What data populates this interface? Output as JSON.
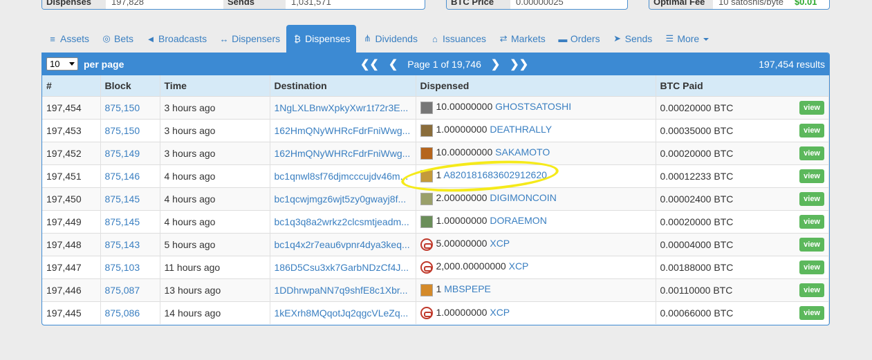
{
  "stats": [
    {
      "label": "Dispenses",
      "value": "197,828"
    },
    {
      "label": "Sends",
      "value": "1,031,571"
    },
    {
      "label": "BTC Price",
      "value": "0.00000025"
    },
    {
      "label": "Optimal Fee",
      "value": "10 satoshis/byte",
      "extra": "$0.01"
    }
  ],
  "tabs": [
    {
      "label": "Assets",
      "icon": "database-icon",
      "glyph": "≡"
    },
    {
      "label": "Bets",
      "icon": "target-icon",
      "glyph": "◎"
    },
    {
      "label": "Broadcasts",
      "icon": "bullhorn-icon",
      "glyph": "◄"
    },
    {
      "label": "Dispensers",
      "icon": "arrows-h-icon",
      "glyph": "↔"
    },
    {
      "label": "Dispenses",
      "icon": "bitcoin-icon",
      "glyph": "₿"
    },
    {
      "label": "Dividends",
      "icon": "sitemap-icon",
      "glyph": "⋔"
    },
    {
      "label": "Issuances",
      "icon": "bank-icon",
      "glyph": "⌂"
    },
    {
      "label": "Markets",
      "icon": "exchange-icon",
      "glyph": "⇄"
    },
    {
      "label": "Orders",
      "icon": "book-icon",
      "glyph": "▬"
    },
    {
      "label": "Sends",
      "icon": "paper-plane-icon",
      "glyph": "➤"
    },
    {
      "label": "More",
      "icon": "list-icon",
      "glyph": "☰"
    }
  ],
  "panel": {
    "per_page_value": "10",
    "per_page_label": "per page",
    "page_text": "Page 1 of 19,746",
    "results": "197,454 results"
  },
  "columns": [
    "#",
    "Block",
    "Time",
    "Destination",
    "Dispensed",
    "BTC Paid"
  ],
  "rows": [
    {
      "num": "197,454",
      "block": "875,150",
      "time": "3 hours ago",
      "dest": "1NgLXLBnwXpkyXwr1t72r3E...",
      "qty": "10.00000000",
      "asset": "GHOSTSATOSHI",
      "icon": "qr",
      "paid": "0.00020000 BTC"
    },
    {
      "num": "197,453",
      "block": "875,150",
      "time": "3 hours ago",
      "dest": "162HmQNyWHRcFdrFniWwg...",
      "qty": "1.00000000",
      "asset": "DEATHRALLY",
      "icon": "img",
      "paid": "0.00035000 BTC"
    },
    {
      "num": "197,452",
      "block": "875,149",
      "time": "3 hours ago",
      "dest": "162HmQNyWHRcFdrFniWwg...",
      "qty": "10.00000000",
      "asset": "SAKAMOTO",
      "icon": "img",
      "paid": "0.00020000 BTC"
    },
    {
      "num": "197,451",
      "block": "875,146",
      "time": "4 hours ago",
      "dest": "bc1qnwl8sf76djmcccujdv46m...",
      "qty": "1",
      "asset": "A820181683602912620",
      "icon": "img",
      "paid": "0.00012233 BTC"
    },
    {
      "num": "197,450",
      "block": "875,145",
      "time": "4 hours ago",
      "dest": "bc1qcwjmgz6wjt5zy0gwayj8f...",
      "qty": "2.00000000",
      "asset": "DIGIMONCOIN",
      "icon": "img",
      "paid": "0.00002400 BTC"
    },
    {
      "num": "197,449",
      "block": "875,145",
      "time": "4 hours ago",
      "dest": "bc1q3q8a2wrkz2clcsmtjeadm...",
      "qty": "1.00000000",
      "asset": "DORAEMON",
      "icon": "img",
      "paid": "0.00020000 BTC"
    },
    {
      "num": "197,448",
      "block": "875,143",
      "time": "5 hours ago",
      "dest": "bc1q4x2r7eau6vpnr4dya3keq...",
      "qty": "5.00000000",
      "asset": "XCP",
      "icon": "xcp",
      "paid": "0.00004000 BTC"
    },
    {
      "num": "197,447",
      "block": "875,103",
      "time": "11 hours ago",
      "dest": "186D5Csu3xk7GarbNDzCf4J...",
      "qty": "2,000.00000000",
      "asset": "XCP",
      "icon": "xcp",
      "paid": "0.00188000 BTC"
    },
    {
      "num": "197,446",
      "block": "875,087",
      "time": "13 hours ago",
      "dest": "1DDhrwpaNN7q9shfE8c1Xbr...",
      "qty": "1",
      "asset": "MBSPEPE",
      "icon": "img",
      "paid": "0.00110000 BTC"
    },
    {
      "num": "197,445",
      "block": "875,086",
      "time": "14 hours ago",
      "dest": "1kEXrh8MQqotJq2qgcVLeZq...",
      "qty": "1.00000000",
      "asset": "XCP",
      "icon": "xcp",
      "paid": "0.00066000 BTC"
    }
  ],
  "view_label": "view",
  "icon_colors": [
    "#777777",
    "#8a6d3b",
    "#b5651d",
    "#c49a3a",
    "#9aa06a",
    "#6b8e5a",
    "#c0392b",
    "#c0392b",
    "#d48a2a",
    "#c0392b"
  ]
}
